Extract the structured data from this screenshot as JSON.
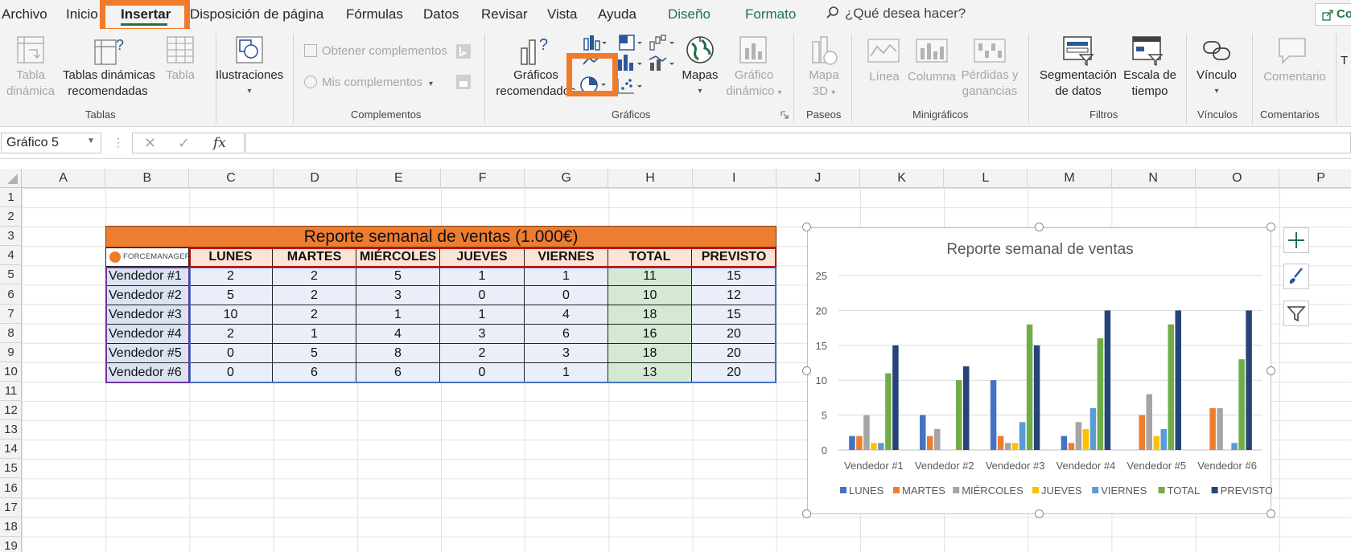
{
  "ribbon_tabs": [
    "Archivo",
    "Inicio",
    "Insertar",
    "Disposición de página",
    "Fórmulas",
    "Datos",
    "Revisar",
    "Vista",
    "Ayuda",
    "Diseño",
    "Formato"
  ],
  "search_placeholder": "¿Qué desea hacer?",
  "share_label": "Co",
  "ribbon": {
    "tablas": {
      "tabla_dinamica": [
        "Tabla",
        "dinámica"
      ],
      "tablas_recomendadas": [
        "Tablas dinámicas",
        "recomendadas"
      ],
      "tabla": "Tabla",
      "group": "Tablas"
    },
    "ilustraciones": {
      "label": "Ilustraciones"
    },
    "complementos": {
      "obtener": "Obtener complementos",
      "mis": "Mis complementos",
      "group": "Complementos"
    },
    "graficos": {
      "recomendados": [
        "Gráficos",
        "recomendados"
      ],
      "mapas": "Mapas",
      "dinamico": [
        "Gráfico",
        "dinámico"
      ],
      "group": "Gráficos"
    },
    "paseos": {
      "mapa3d": [
        "Mapa",
        "3D"
      ],
      "group": "Paseos"
    },
    "minigraficos": {
      "linea": "Línea",
      "columna": "Columna",
      "perdidas": [
        "Pérdidas y",
        "ganancias"
      ],
      "group": "Minigráficos"
    },
    "filtros": {
      "segmentacion": [
        "Segmentación",
        "de datos"
      ],
      "escala": [
        "Escala de",
        "tiempo"
      ],
      "group": "Filtros"
    },
    "vinculos": {
      "vinculo": "Vínculo",
      "group": "Vínculos"
    },
    "comentarios": {
      "comentario": "Comentario",
      "group": "Comentarios"
    },
    "text_partial": "T"
  },
  "name_box": "Gráfico 5",
  "fx_label": "fx",
  "column_headers": [
    "A",
    "B",
    "C",
    "D",
    "E",
    "F",
    "G",
    "H",
    "I",
    "J",
    "K",
    "L",
    "M",
    "N",
    "O",
    "P"
  ],
  "row_headers": [
    "1",
    "2",
    "3",
    "4",
    "5",
    "6",
    "7",
    "8",
    "9",
    "10",
    "11",
    "12",
    "13",
    "14",
    "15",
    "16",
    "17",
    "18",
    "19"
  ],
  "table": {
    "title": "Reporte semanal de ventas (1.000€)",
    "logo_text": "FORCEMANAGER.",
    "headers": [
      "LUNES",
      "MARTES",
      "MIÉRCOLES",
      "JUEVES",
      "VIERNES",
      "TOTAL",
      "PREVISTO"
    ],
    "rows": [
      {
        "name": "Vendedor #1",
        "values": [
          "2",
          "2",
          "5",
          "1",
          "1",
          "11",
          "15"
        ]
      },
      {
        "name": "Vendedor #2",
        "values": [
          "5",
          "2",
          "3",
          "0",
          "0",
          "10",
          "12"
        ]
      },
      {
        "name": "Vendedor #3",
        "values": [
          "10",
          "2",
          "1",
          "1",
          "4",
          "18",
          "15"
        ]
      },
      {
        "name": "Vendedor #4",
        "values": [
          "2",
          "1",
          "4",
          "3",
          "6",
          "16",
          "20"
        ]
      },
      {
        "name": "Vendedor #5",
        "values": [
          "0",
          "5",
          "8",
          "2",
          "3",
          "18",
          "20"
        ]
      },
      {
        "name": "Vendedor #6",
        "values": [
          "0",
          "6",
          "6",
          "0",
          "1",
          "13",
          "20"
        ]
      }
    ]
  },
  "chart_data": {
    "type": "bar",
    "title": "Reporte semanal de ventas",
    "categories": [
      "Vendedor #1",
      "Vendedor #2",
      "Vendedor #3",
      "Vendedor #4",
      "Vendedor #5",
      "Vendedor #6"
    ],
    "series": [
      {
        "name": "LUNES",
        "color": "#4472c4",
        "values": [
          2,
          5,
          10,
          2,
          0,
          0
        ]
      },
      {
        "name": "MARTES",
        "color": "#ed7d31",
        "values": [
          2,
          2,
          2,
          1,
          5,
          6
        ]
      },
      {
        "name": "MIÉRCOLES",
        "color": "#a5a5a5",
        "values": [
          5,
          3,
          1,
          4,
          8,
          6
        ]
      },
      {
        "name": "JUEVES",
        "color": "#ffc000",
        "values": [
          1,
          0,
          1,
          3,
          2,
          0
        ]
      },
      {
        "name": "VIERNES",
        "color": "#5b9bd5",
        "values": [
          1,
          0,
          4,
          6,
          3,
          1
        ]
      },
      {
        "name": "TOTAL",
        "color": "#70ad47",
        "values": [
          11,
          10,
          18,
          16,
          18,
          13
        ]
      },
      {
        "name": "PREVISTO",
        "color": "#264478",
        "values": [
          15,
          12,
          15,
          20,
          20,
          20
        ]
      }
    ],
    "yticks": [
      "0",
      "5",
      "10",
      "15",
      "20",
      "25"
    ],
    "ylim": [
      0,
      25
    ],
    "grid": true,
    "legend": "bottom"
  },
  "colors": {
    "accent": "#217346",
    "highlight": "#f07b2b",
    "title_fill": "#ed7d31"
  }
}
